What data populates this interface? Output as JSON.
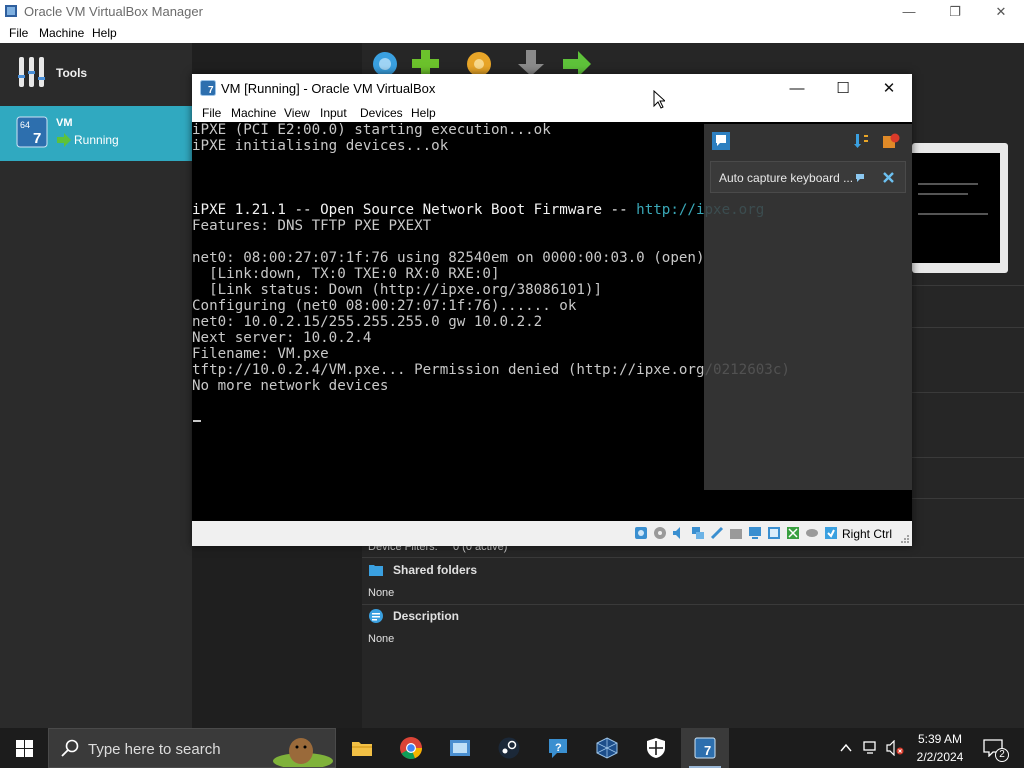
{
  "manager": {
    "title": "Oracle VM VirtualBox Manager",
    "menu": [
      "File",
      "Machine",
      "Help"
    ],
    "tools_label": "Tools",
    "vm": {
      "name": "VM",
      "state": "Running",
      "os_badge": "64"
    },
    "details": {
      "device_filters_label": "Device Filters:",
      "device_filters_value": "0 (0 active)",
      "shared_folders_title": "Shared folders",
      "shared_folders_value": "None",
      "description_title": "Description",
      "description_value": "None"
    }
  },
  "vm_window": {
    "title": "VM [Running] - Oracle VM VirtualBox",
    "menu": [
      "File",
      "Machine",
      "View",
      "Input",
      "Devices",
      "Help"
    ],
    "console_lines": [
      "iPXE (PCI E2:00.0) starting execution...ok",
      "iPXE initialising devices...ok",
      "",
      "",
      "iPXE 1.21.1 -- Open Source Network Boot Firmware -- ",
      "Features: DNS TFTP PXE PXEXT",
      "",
      "net0: 08:00:27:07:1f:76 using 82540em on 0000:00:03.0 (open)",
      "  [Link:down, TX:0 TXE:0 RX:0 RXE:0]",
      "  [Link status: Down (http://ipxe.org/38086101)]",
      "Configuring (net0 08:00:27:07:1f:76)...... ok",
      "net0: 10.0.2.15/255.255.255.0 gw 10.0.2.2",
      "Next server: 10.0.2.4",
      "Filename: VM.pxe",
      "tftp://10.0.2.4/VM.pxe... Permission denied (http://ipxe.org/0212603c)",
      "No more network devices"
    ],
    "console_link": "http://ipxe.org",
    "notification": "Auto capture keyboard ...",
    "host_key": "Right Ctrl"
  },
  "taskbar": {
    "search_placeholder": "Type here to search",
    "time": "5:39 AM",
    "date": "2/2/2024",
    "notification_count": "2"
  },
  "colors": {
    "selection": "#30a9c0",
    "console_bg": "#000000",
    "console_text": "#c8c8c8",
    "link": "#3aa8b8"
  }
}
